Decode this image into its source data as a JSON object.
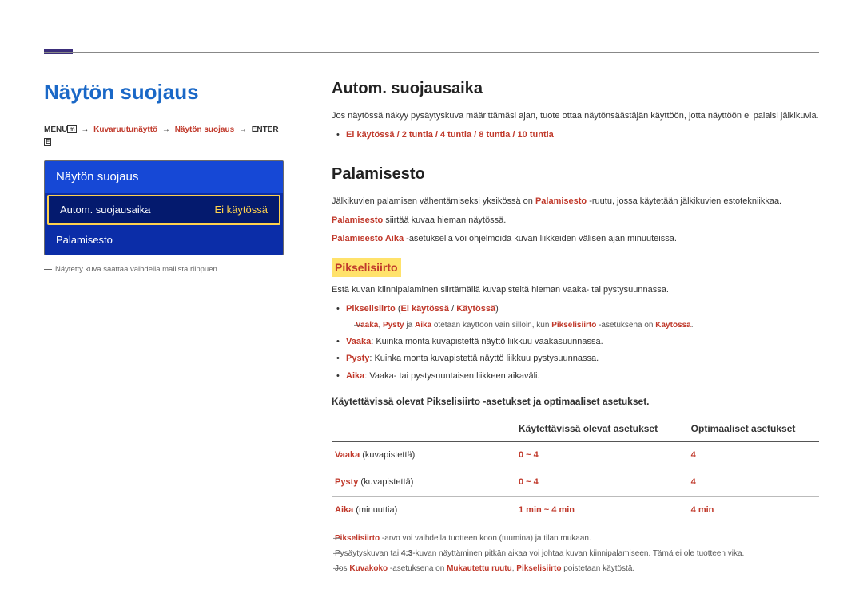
{
  "left": {
    "title": "Näytön suojaus",
    "breadcrumb": {
      "menu": "MENU",
      "menu_icon": "m",
      "p1": "Kuvaruutunäyttö",
      "p2": "Näytön suojaus",
      "enter": "ENTER",
      "enter_icon": "E"
    },
    "osd": {
      "header": "Näytön suojaus",
      "row1_label": "Autom. suojausaika",
      "row1_value": "Ei käytössä",
      "row2_label": "Palamisesto"
    },
    "note": "Näytetty kuva saattaa vaihdella mallista riippuen."
  },
  "autom": {
    "heading": "Autom. suojausaika",
    "text": "Jos näytössä näkyy pysäytyskuva määrittämäsi ajan, tuote ottaa näytönsäästäjän käyttöön, jotta näyttöön ei palaisi jälkikuvia.",
    "options": "Ei käytössä / 2 tuntia / 4 tuntia / 8 tuntia / 10 tuntia"
  },
  "palamisesto": {
    "heading": "Palamisesto",
    "line1_a": "Jälkikuvien palamisen vähentämiseksi yksikössä on ",
    "line1_b": "Palamisesto",
    "line1_c": " -ruutu, jossa käytetään jälkikuvien estotekniikkaa.",
    "line2_a": "Palamisesto",
    "line2_b": " siirtää kuvaa hieman näytössä.",
    "line3_a": "Palamisesto Aika",
    "line3_b": " -asetuksella voi ohjelmoida kuvan liikkeiden välisen ajan minuuteissa."
  },
  "pikselisiirto": {
    "label": "Pikselisiirto",
    "intro": "Estä kuvan kiinnipalaminen siirtämällä kuvapisteitä hieman vaaka- tai pystysuunnassa.",
    "opt_line_a": "Pikselisiirto",
    "opt_line_b": " (",
    "opt_line_c": "Ei käytössä",
    "opt_line_d": " / ",
    "opt_line_e": "Käytössä",
    "opt_line_f": ")",
    "sub_note_a": "Vaaka",
    "sub_note_b": "Pysty",
    "sub_note_c": "Aika",
    "sub_note_rest1": " ja ",
    "sub_note_rest2": " otetaan käyttöön vain silloin, kun ",
    "sub_note_rest3": "Pikselisiirto",
    "sub_note_rest4": " -asetuksena on ",
    "sub_note_rest5": "Käytössä",
    "sub_note_rest6": ".",
    "vaaka_label": "Vaaka",
    "vaaka_text": ": Kuinka monta kuvapistettä näyttö liikkuu vaakasuunnassa.",
    "pysty_label": "Pysty",
    "pysty_text": ": Kuinka monta kuvapistettä näyttö liikkuu pystysuunnassa.",
    "aika_label": "Aika",
    "aika_text": ": Vaaka- tai pystysuuntaisen liikkeen aikaväli."
  },
  "table": {
    "caption": "Käytettävissä olevat Pikselisiirto -asetukset ja optimaaliset asetukset.",
    "th1": "",
    "th2": "Käytettävissä olevat asetukset",
    "th3": "Optimaaliset asetukset",
    "rows": [
      {
        "label_b": "Vaaka",
        "label_p": " (kuvapistettä)",
        "range": "0 ~ 4",
        "opt": "4"
      },
      {
        "label_b": "Pysty",
        "label_p": " (kuvapistettä)",
        "range": "0 ~ 4",
        "opt": "4"
      },
      {
        "label_b": "Aika",
        "label_p": " (minuuttia)",
        "range": "1 min ~ 4 min",
        "opt": "4 min"
      }
    ]
  },
  "footnotes": {
    "n1_a": "Pikselisiirto",
    "n1_b": " -arvo voi vaihdella tuotteen koon (tuumina) ja tilan mukaan.",
    "n2_a": "Pysäytyskuvan tai ",
    "n2_b": "4:3",
    "n2_c": "-kuvan näyttäminen pitkän aikaa voi johtaa kuvan kiinnipalamiseen. Tämä ei ole tuotteen vika.",
    "n3_a": "Jos ",
    "n3_b": "Kuvakoko",
    "n3_c": " -asetuksena on ",
    "n3_d": "Mukautettu ruutu",
    "n3_e": ", ",
    "n3_f": "Pikselisiirto",
    "n3_g": " poistetaan käytöstä."
  }
}
